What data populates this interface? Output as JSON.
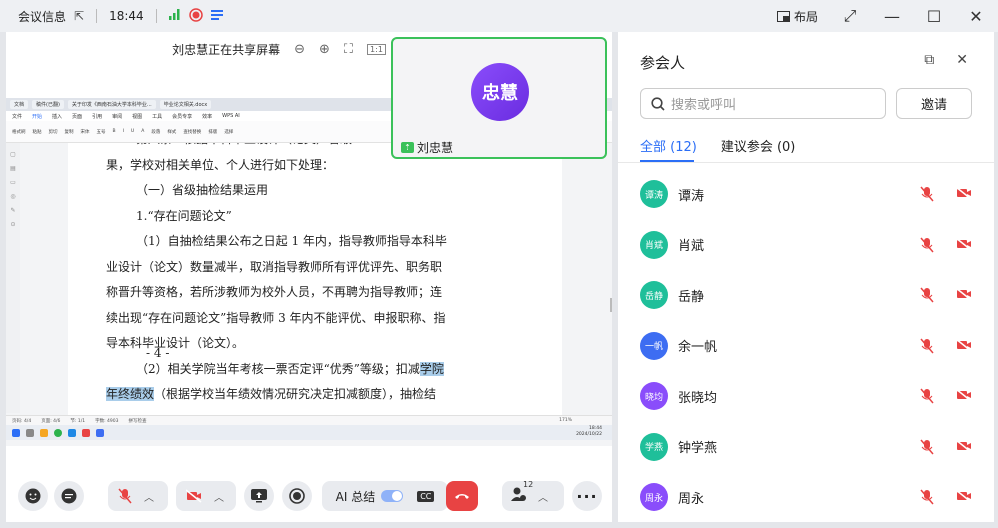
{
  "titlebar": {
    "title": "会议信息",
    "time": "18:44",
    "layout_label": "布局"
  },
  "share": {
    "banner": "刘忠慧正在共享屏幕"
  },
  "wps": {
    "tabs": [
      "文档",
      "稿件(已翻)",
      "关于印发《西南石油大学本科毕业...",
      "毕业论文相关.docx"
    ],
    "menu": [
      "文件",
      "开始",
      "插入",
      "页面",
      "引用",
      "审阅",
      "视图",
      "工具",
      "会员专享",
      "效率",
      "WPS AI"
    ],
    "toolbar": [
      "格式刷",
      "粘贴",
      "剪切",
      "复制",
      "宋体",
      "五号",
      "B",
      "I",
      "U",
      "A",
      "段落",
      "样式",
      "查找替换",
      "排版",
      "选择"
    ],
    "status": [
      "页码: 4/4",
      "页面: 4/6",
      "节: 1/1",
      "字数: 4903",
      "拼写检查"
    ],
    "zoom": "171%"
  },
  "document": {
    "lines": [
      {
        "text": "第八条　依据本科毕业设计（论文）省级",
        "hl": ""
      },
      {
        "text": "果，学校对相关单位、个人进行如下处理：",
        "hl": ""
      },
      {
        "text": "（一）省级抽检结果运用",
        "hl": ""
      },
      {
        "text": "1.“存在问题论文”",
        "hl": ""
      },
      {
        "text": "（1）自抽检结果公布之日起 1 年内，指导教师指导本科毕",
        "hl": ""
      },
      {
        "text": "业设计（论文）数量减半，取消指导教师所有评优评先、职务职",
        "hl": ""
      },
      {
        "text": "称晋升等资格，若所涉教师为校外人员，不再聘为指导教师；连",
        "hl": ""
      },
      {
        "text": "续出现“存在问题论文”指导教师 3 年内不能评优、申报职称、指",
        "hl": ""
      },
      {
        "text": "导本科毕业设计（论文）。",
        "hl": ""
      },
      {
        "text": "（2）相关学院当年考核一票否定评“优秀”等级；扣减",
        "hl": "学院"
      },
      {
        "text": "",
        "hl": "年终绩效",
        "after": "（根据学校当年绩效情况研究决定扣减额度），抽检结"
      }
    ],
    "page_number": "- 4 -"
  },
  "taskbar": {
    "time": "18:44",
    "date": "2024/10/22"
  },
  "video": {
    "avatar_text": "忠慧",
    "name": "刘忠慧"
  },
  "controls": {
    "ai_summary": "AI 总结",
    "cc": "CC",
    "participants_count": "12"
  },
  "panel": {
    "title": "参会人",
    "search_placeholder": "搜索或呼叫",
    "invite": "邀请",
    "tabs": [
      "全部 (12)",
      "建议参会 (0)"
    ],
    "participants": [
      {
        "avatar": "谭涛",
        "name": "谭涛",
        "color": "#1fbf9a"
      },
      {
        "avatar": "肖斌",
        "name": "肖斌",
        "color": "#1fbf9a"
      },
      {
        "avatar": "岳静",
        "name": "岳静",
        "color": "#1fbf9a"
      },
      {
        "avatar": "一帆",
        "name": "余一帆",
        "color": "#3d6df2"
      },
      {
        "avatar": "晓均",
        "name": "张晓均",
        "color": "#8a4dfb"
      },
      {
        "avatar": "学燕",
        "name": "钟学燕",
        "color": "#1fbf9a"
      },
      {
        "avatar": "周永",
        "name": "周永",
        "color": "#8a4dfb"
      }
    ]
  },
  "colors": {
    "accent": "#2b6ef6",
    "danger": "#e84343",
    "share_green": "#3bc15a"
  }
}
